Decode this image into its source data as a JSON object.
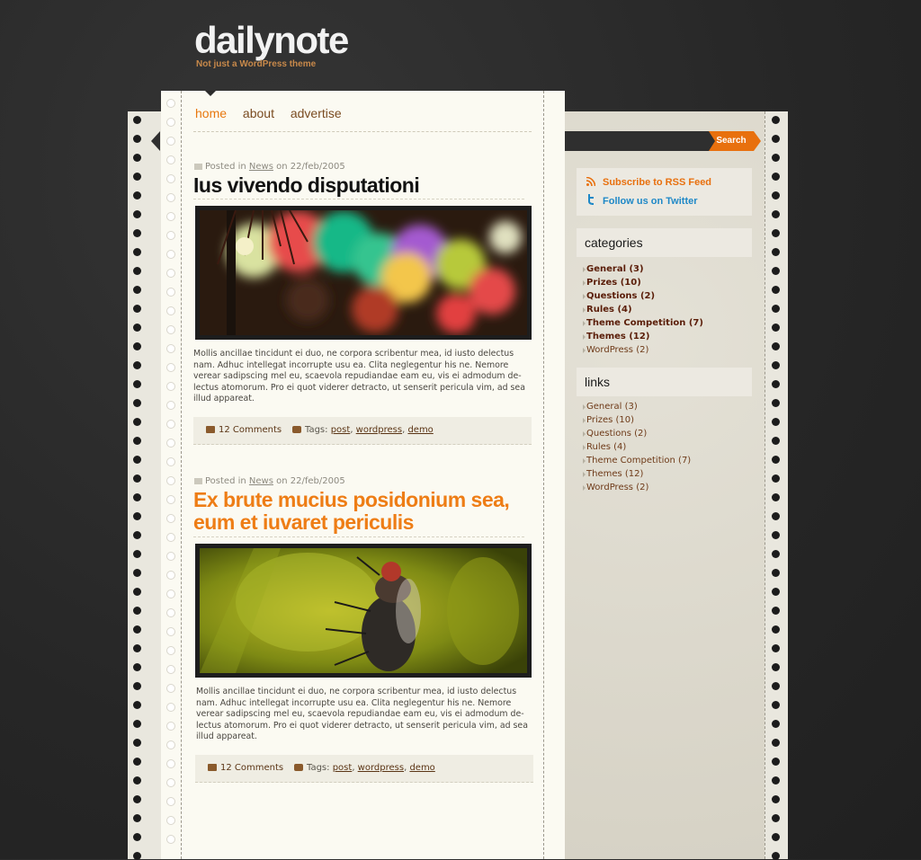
{
  "site": {
    "title": "dailynote",
    "tagline": "Not just a WordPress theme"
  },
  "nav": {
    "items": [
      "home",
      "about",
      "advertise"
    ],
    "active": "home"
  },
  "search": {
    "button_label": "Search"
  },
  "posts": [
    {
      "meta_prefix": "Posted in",
      "category": "News",
      "date_text": "on 22/feb/2005",
      "title": "Ius vivendo disputationi",
      "excerpt": "Mollis ancillae tincidunt ei duo, ne corpora scribentur mea, id iusto delectus nam. Adhuc intellegat incorrupte usu ea. Clita neglegentur his ne. Nemore verear sadipscing mel eu, scaevola repudiandae eam eu, vis ei admodum de-lectus atomorum. Pro ei quot viderer detracto, ut senserit pericula vim, ad sea illud appareat.",
      "comments": "12 Comments",
      "tags_label": "Tags:",
      "tags": [
        "post",
        "wordpress",
        "demo"
      ],
      "image": "bokeh-lights"
    },
    {
      "meta_prefix": "Posted in",
      "category": "News",
      "date_text": "on 22/feb/2005",
      "title": "Ex brute mucius posidonium sea, eum et iuvaret periculis",
      "excerpt": "Mollis ancillae tincidunt ei duo, ne corpora scribentur mea, id iusto delectus nam. Adhuc intellegat incorrupte usu ea. Clita neglegentur his ne. Nemore verear sadipscing mel eu, scaevola repudiandae eam eu, vis ei admodum de-lectus atomorum. Pro ei quot viderer detracto, ut senserit pericula vim, ad sea illud appareat.",
      "comments": "12 Comments",
      "tags_label": "Tags:",
      "tags": [
        "post",
        "wordpress",
        "demo"
      ],
      "image": "fly-on-leaf"
    }
  ],
  "sidebar": {
    "rss_label": "Subscribe to RSS Feed",
    "twitter_label": "Follow us on Twitter",
    "categories_title": "categories",
    "categories": [
      "General (3)",
      "Prizes (10)",
      "Questions (2)",
      "Rules (4)",
      "Theme Competition (7)",
      "Themes (12)",
      "WordPress (2)"
    ],
    "links_title": "links",
    "links": [
      "General (3)",
      "Prizes (10)",
      "Questions (2)",
      "Rules (4)",
      "Theme Competition (7)",
      "Themes (12)",
      "WordPress (2)"
    ]
  },
  "colors": {
    "accent": "#e8700e",
    "background": "#2b2b2b",
    "paper": "#fbfaf2",
    "link_brown": "#5a1d08",
    "twitter_blue": "#1e88c7"
  }
}
